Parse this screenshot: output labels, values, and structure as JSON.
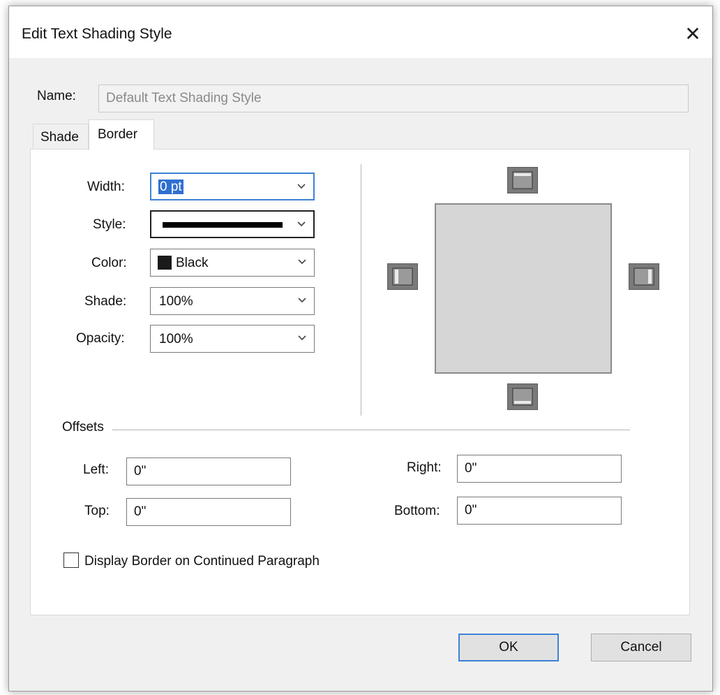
{
  "window": {
    "title": "Edit Text Shading Style",
    "close_glyph": "✕"
  },
  "name": {
    "label": "Name:",
    "value": "Default Text Shading Style"
  },
  "tabs": [
    {
      "label": "Shade",
      "selected": false
    },
    {
      "label": "Border",
      "selected": true
    }
  ],
  "border": {
    "width": {
      "label": "Width:",
      "value": "0 pt"
    },
    "style": {
      "label": "Style:"
    },
    "color": {
      "label": "Color:",
      "value": "Black",
      "swatch": "#1a1a1a"
    },
    "shade": {
      "label": "Shade:",
      "value": "100%"
    },
    "opacity": {
      "label": "Opacity:",
      "value": "100%"
    }
  },
  "offsets": {
    "heading": "Offsets",
    "left": {
      "label": "Left:",
      "value": "0\""
    },
    "right": {
      "label": "Right:",
      "value": "0\""
    },
    "top": {
      "label": "Top:",
      "value": "0\""
    },
    "bottom": {
      "label": "Bottom:",
      "value": "0\""
    }
  },
  "continued": {
    "label": "Display Border on Continued Paragraph",
    "checked": false
  },
  "buttons": {
    "ok": "OK",
    "cancel": "Cancel"
  },
  "icons": {
    "chevron": "chevron-down-icon",
    "border_top": "border-top-icon",
    "border_bottom": "border-bottom-icon",
    "border_left": "border-left-icon",
    "border_right": "border-right-icon"
  },
  "colors": {
    "accent": "#3c83d6",
    "selection": "#2f6fd1"
  }
}
